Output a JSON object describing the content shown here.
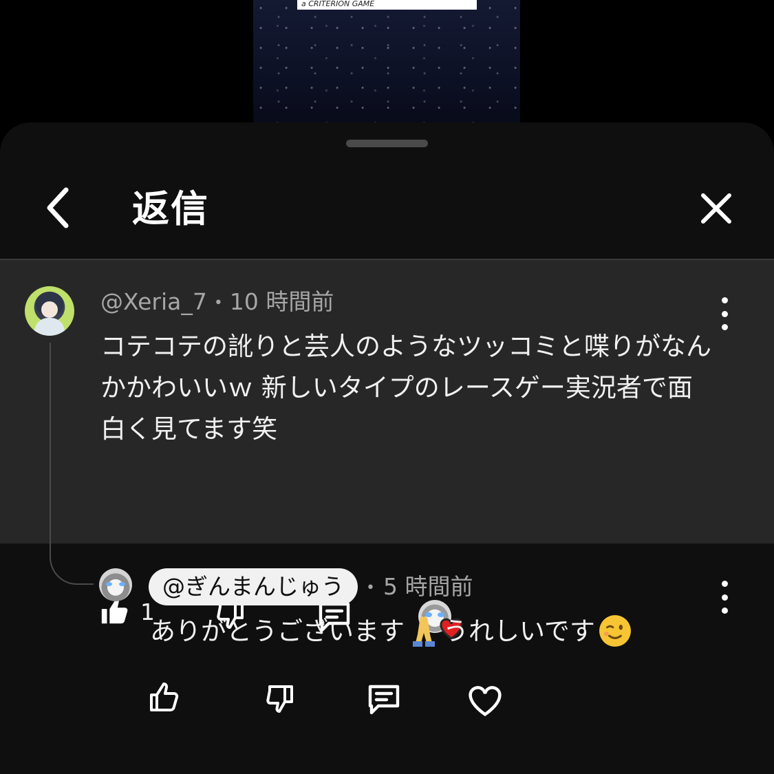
{
  "video": {
    "caption": "a CRITERION GAME"
  },
  "header": {
    "title": "返信"
  },
  "main_comment": {
    "author": "@Xeria_7",
    "time": "10 時間前",
    "text": "コテコテの訛りと芸人のようなツッコミと喋りがなんかかわいいｗ 新しいタイプのレースゲー実況者で面白く見てます笑",
    "like_count": "1"
  },
  "reply": {
    "author": "@ぎんまんじゅう",
    "time": "5 時間前",
    "text_part1": "ありがとうございます",
    "text_part2": "うれしいです"
  },
  "icons": {
    "back": "chevron-left-icon",
    "close": "close-icon",
    "like": "thumbs-up-icon",
    "dislike": "thumbs-down-icon",
    "reply": "comment-icon",
    "heart": "heart-icon",
    "more": "more-vertical-icon"
  },
  "colors": {
    "background": "#0f0f0f",
    "highlight": "#272727",
    "heart": "#e02020"
  }
}
